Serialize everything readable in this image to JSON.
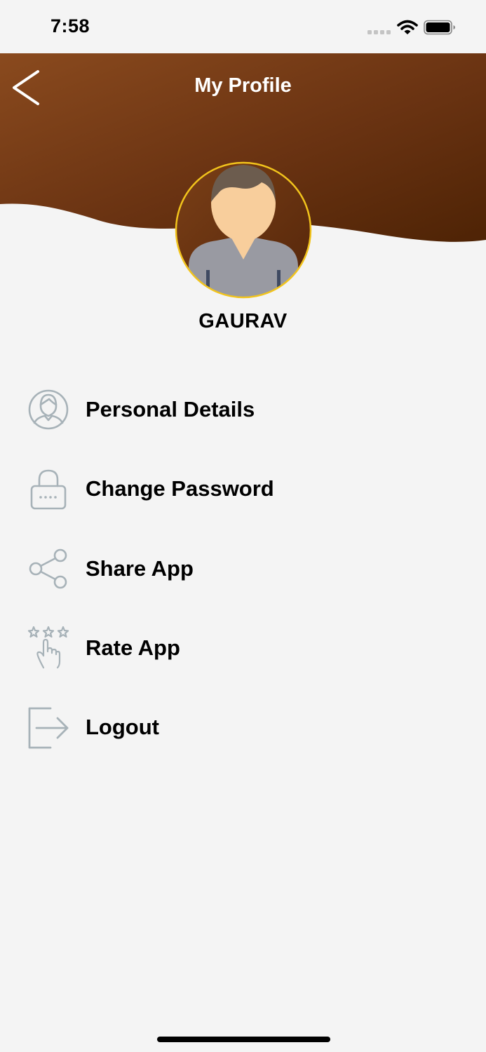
{
  "status_bar": {
    "time": "7:58"
  },
  "header": {
    "title": "My Profile",
    "back_icon": "chevron-left-icon",
    "gradient_start": "#8a4a1e",
    "gradient_end": "#4e2305"
  },
  "profile": {
    "name": "GAURAV",
    "avatar_icon": "user-avatar-icon",
    "avatar_ring_color": "#f2c41c"
  },
  "menu": {
    "items": [
      {
        "label": "Personal Details",
        "icon": "person-icon"
      },
      {
        "label": "Change Password",
        "icon": "lock-icon"
      },
      {
        "label": "Share App",
        "icon": "share-icon"
      },
      {
        "label": "Rate App",
        "icon": "rate-stars-icon"
      },
      {
        "label": "Logout",
        "icon": "logout-icon"
      }
    ],
    "icon_color": "#a7b2b8"
  }
}
